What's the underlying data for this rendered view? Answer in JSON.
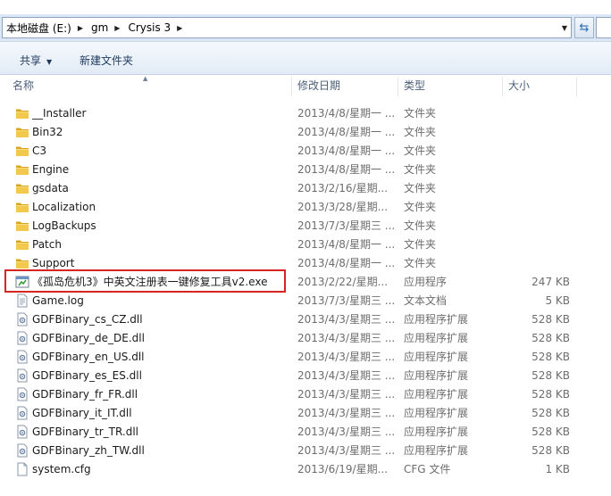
{
  "address_bar": {
    "crumbs": [
      "本地磁盘 (E:)",
      "gm",
      "Crysis 3"
    ]
  },
  "toolbar": {
    "share_label": "共享",
    "new_folder_label": "新建文件夹"
  },
  "columns": {
    "name": "名称",
    "date": "修改日期",
    "type": "类型",
    "size": "大小"
  },
  "files": [
    {
      "name": "__Installer",
      "date": "2013/4/8/星期一 ...",
      "type": "文件夹",
      "size": "",
      "icon": "folder-icon"
    },
    {
      "name": "Bin32",
      "date": "2013/4/8/星期一 ...",
      "type": "文件夹",
      "size": "",
      "icon": "folder-icon"
    },
    {
      "name": "C3",
      "date": "2013/4/8/星期一 ...",
      "type": "文件夹",
      "size": "",
      "icon": "folder-icon"
    },
    {
      "name": "Engine",
      "date": "2013/4/8/星期一 ...",
      "type": "文件夹",
      "size": "",
      "icon": "folder-icon"
    },
    {
      "name": "gsdata",
      "date": "2013/2/16/星期...",
      "type": "文件夹",
      "size": "",
      "icon": "folder-icon"
    },
    {
      "name": "Localization",
      "date": "2013/3/28/星期...",
      "type": "文件夹",
      "size": "",
      "icon": "folder-icon"
    },
    {
      "name": "LogBackups",
      "date": "2013/7/3/星期三 ...",
      "type": "文件夹",
      "size": "",
      "icon": "folder-icon"
    },
    {
      "name": "Patch",
      "date": "2013/4/8/星期一 ...",
      "type": "文件夹",
      "size": "",
      "icon": "folder-icon"
    },
    {
      "name": "Support",
      "date": "2013/4/8/星期一 ...",
      "type": "文件夹",
      "size": "",
      "icon": "folder-icon"
    },
    {
      "name": "《孤岛危机3》中英文注册表一键修复工具v2.exe",
      "date": "2013/2/22/星期...",
      "type": "应用程序",
      "size": "247 KB",
      "icon": "exe-icon"
    },
    {
      "name": "Game.log",
      "date": "2013/7/3/星期三 ...",
      "type": "文本文档",
      "size": "5 KB",
      "icon": "text-file-icon"
    },
    {
      "name": "GDFBinary_cs_CZ.dll",
      "date": "2013/4/3/星期三 ...",
      "type": "应用程序扩展",
      "size": "528 KB",
      "icon": "dll-icon"
    },
    {
      "name": "GDFBinary_de_DE.dll",
      "date": "2013/4/3/星期三 ...",
      "type": "应用程序扩展",
      "size": "528 KB",
      "icon": "dll-icon"
    },
    {
      "name": "GDFBinary_en_US.dll",
      "date": "2013/4/3/星期三 ...",
      "type": "应用程序扩展",
      "size": "528 KB",
      "icon": "dll-icon"
    },
    {
      "name": "GDFBinary_es_ES.dll",
      "date": "2013/4/3/星期三 ...",
      "type": "应用程序扩展",
      "size": "528 KB",
      "icon": "dll-icon"
    },
    {
      "name": "GDFBinary_fr_FR.dll",
      "date": "2013/4/3/星期三 ...",
      "type": "应用程序扩展",
      "size": "528 KB",
      "icon": "dll-icon"
    },
    {
      "name": "GDFBinary_it_IT.dll",
      "date": "2013/4/3/星期三 ...",
      "type": "应用程序扩展",
      "size": "528 KB",
      "icon": "dll-icon"
    },
    {
      "name": "GDFBinary_tr_TR.dll",
      "date": "2013/4/3/星期三 ...",
      "type": "应用程序扩展",
      "size": "528 KB",
      "icon": "dll-icon"
    },
    {
      "name": "GDFBinary_zh_TW.dll",
      "date": "2013/4/3/星期三 ...",
      "type": "应用程序扩展",
      "size": "528 KB",
      "icon": "dll-icon"
    },
    {
      "name": "system.cfg",
      "date": "2013/6/19/星期...",
      "type": "CFG 文件",
      "size": "1 KB",
      "icon": "cfg-file-icon"
    }
  ],
  "colors": {
    "folder": "#e8b93c",
    "highlight": "#d6261f",
    "header_text": "#4c607a",
    "meta_text": "#6d6d6d"
  }
}
